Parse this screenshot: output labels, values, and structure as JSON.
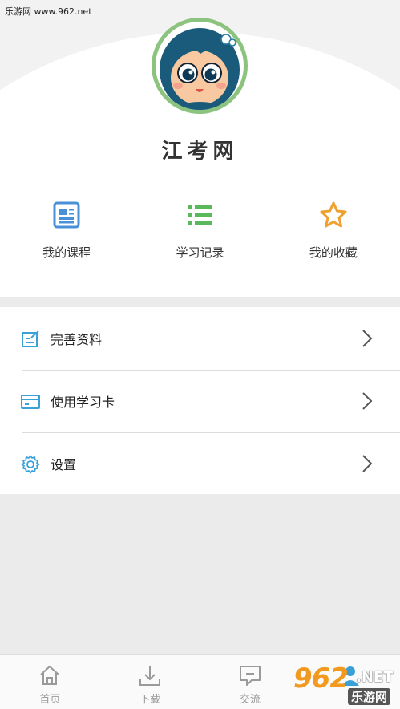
{
  "watermark_top": "乐游网 www.962.net",
  "profile": {
    "site_title": "江考网",
    "avatar_icon": "cartoon-girl-avatar"
  },
  "shortcuts": [
    {
      "label": "我的课程",
      "icon": "course-icon",
      "color": "#4a90d9"
    },
    {
      "label": "学习记录",
      "icon": "list-icon",
      "color": "#5cb85c"
    },
    {
      "label": "我的收藏",
      "icon": "star-icon",
      "color": "#f0a030"
    }
  ],
  "menu": [
    {
      "label": "完善资料",
      "icon": "edit-profile-icon"
    },
    {
      "label": "使用学习卡",
      "icon": "card-icon"
    },
    {
      "label": "设置",
      "icon": "gear-icon"
    }
  ],
  "tabbar": [
    {
      "label": "首页",
      "icon": "home-icon"
    },
    {
      "label": "下载",
      "icon": "download-icon"
    },
    {
      "label": "交流",
      "icon": "chat-icon"
    }
  ],
  "watermark_logo": {
    "big": "962",
    "net": ".NET",
    "cn": "乐游网"
  },
  "colors": {
    "accent_blue": "#3aa0d8",
    "icon_gray": "#9a9a9a"
  }
}
